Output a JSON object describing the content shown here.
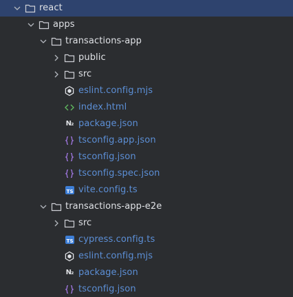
{
  "tree": {
    "rows": [
      {
        "label": "react",
        "kind": "dir",
        "expanded": true,
        "icon": "folder-icon",
        "selected": true
      },
      {
        "label": "apps",
        "kind": "dir",
        "expanded": true,
        "icon": "folder-icon"
      },
      {
        "label": "transactions-app",
        "kind": "dir",
        "expanded": true,
        "icon": "folder-icon"
      },
      {
        "label": "public",
        "kind": "dir",
        "expanded": false,
        "icon": "folder-icon"
      },
      {
        "label": "src",
        "kind": "dir",
        "expanded": false,
        "icon": "folder-icon"
      },
      {
        "label": "eslint.config.mjs",
        "kind": "file",
        "icon": "eslint-icon"
      },
      {
        "label": "index.html",
        "kind": "file",
        "icon": "html-icon"
      },
      {
        "label": "package.json",
        "kind": "file",
        "icon": "npm-icon"
      },
      {
        "label": "tsconfig.app.json",
        "kind": "file",
        "icon": "json-icon"
      },
      {
        "label": "tsconfig.json",
        "kind": "file",
        "icon": "json-icon"
      },
      {
        "label": "tsconfig.spec.json",
        "kind": "file",
        "icon": "json-icon"
      },
      {
        "label": "vite.config.ts",
        "kind": "file",
        "icon": "typescript-icon"
      },
      {
        "label": "transactions-app-e2e",
        "kind": "dir",
        "expanded": true,
        "icon": "folder-icon"
      },
      {
        "label": "src",
        "kind": "dir",
        "expanded": false,
        "icon": "folder-icon"
      },
      {
        "label": "cypress.config.ts",
        "kind": "file",
        "icon": "typescript-icon"
      },
      {
        "label": "eslint.config.mjs",
        "kind": "file",
        "icon": "eslint-icon"
      },
      {
        "label": "package.json",
        "kind": "file",
        "icon": "npm-icon"
      },
      {
        "label": "tsconfig.json",
        "kind": "file",
        "icon": "json-icon"
      }
    ]
  },
  "icons": {
    "ts_text": "TS",
    "npm_text": "N₂"
  },
  "colors": {
    "background": "#2b2d30",
    "selection": "#2e436e",
    "folder_text": "#dfe1e5",
    "file_text": "#5c8fd6",
    "typescript_badge": "#3d7ed6",
    "html_icon": "#5fb85f",
    "json_icon": "#a077e0"
  }
}
